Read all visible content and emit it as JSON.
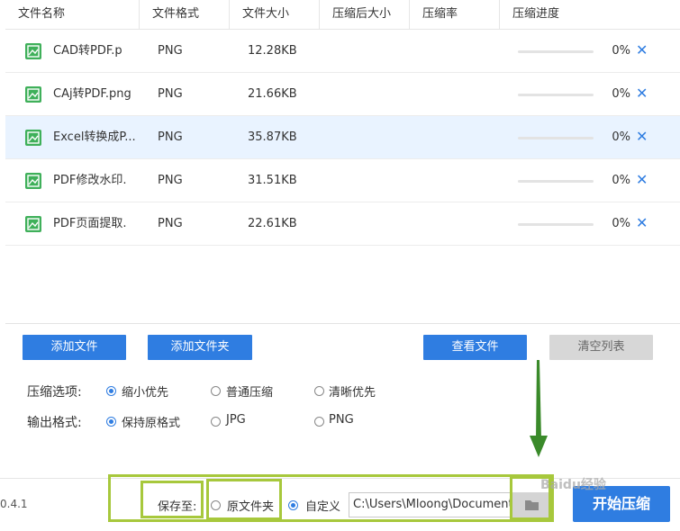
{
  "table": {
    "headers": [
      "文件名称",
      "文件格式",
      "文件大小",
      "压缩后大小",
      "压缩率",
      "压缩进度"
    ],
    "rows": [
      {
        "name": "CAD转PDF.p",
        "format": "PNG",
        "size": "12.28KB",
        "progress": 0,
        "percent": "0%",
        "highlighted": false
      },
      {
        "name": "CAj转PDF.png",
        "format": "PNG",
        "size": "21.66KB",
        "progress": 0,
        "percent": "0%",
        "highlighted": false
      },
      {
        "name": "Excel转换成P...",
        "format": "PNG",
        "size": "35.87KB",
        "progress": 0,
        "percent": "0%",
        "highlighted": true
      },
      {
        "name": "PDF修改水印.",
        "format": "PNG",
        "size": "31.51KB",
        "progress": 0,
        "percent": "0%",
        "highlighted": false
      },
      {
        "name": "PDF页面提取.",
        "format": "PNG",
        "size": "22.61KB",
        "progress": 0,
        "percent": "0%",
        "highlighted": false
      }
    ],
    "delete_glyph": "✕",
    "file_icon": "image-file-icon"
  },
  "actions": {
    "add_file": "添加文件",
    "add_folder": "添加文件夹",
    "view_files": "查看文件",
    "clear_list": "清空列表"
  },
  "options": {
    "compress_label": "压缩选项:",
    "compress_choices": [
      "缩小优先",
      "普通压缩",
      "清晰优先"
    ],
    "compress_selected": "缩小优先",
    "format_label": "输出格式:",
    "format_choices": [
      "保持原格式",
      "JPG",
      "PNG"
    ],
    "format_selected": "保持原格式"
  },
  "bottom": {
    "version": "0.4.1",
    "save_to_label": "保存至:",
    "original_folder": "原文件夹",
    "custom": "自定义",
    "custom_selected": true,
    "path_value": "C:\\Users\\Mloong\\Documents",
    "folder_icon": "folder-icon",
    "start_button": "开始压缩"
  },
  "colors": {
    "accent": "#2f7de1",
    "annotation": "#a7c83c",
    "arrow": "#3a8a2a",
    "row_highlight": "#e9f3ff"
  },
  "watermark": "Baidu经验"
}
